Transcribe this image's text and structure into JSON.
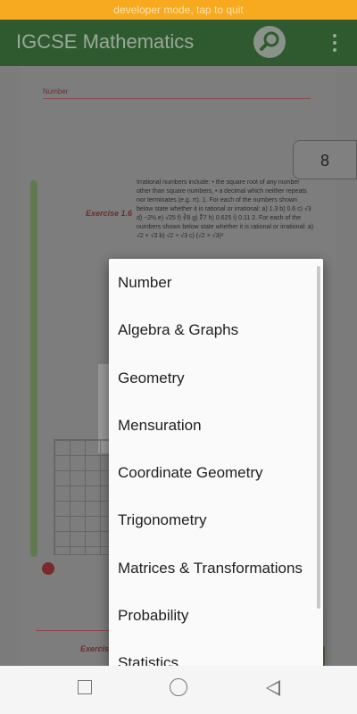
{
  "banner": {
    "text": "developer mode, tap to quit"
  },
  "appbar": {
    "title": "IGCSE Mathematics"
  },
  "page": {
    "section_label": "Number",
    "page_number": "8",
    "exercise_title": "Exercise 1.6",
    "text": "Irrational numbers include: • the square root of any number other than square numbers, • a decimal which neither repeats nor terminates (e.g. π). 1. For each of the numbers shown below state whether it is rational or irrational: a) 1.3 b) 0.6 c) √3 d) −2⅔ e) √25 f) ∛8 g) ∜7 h) 0.625 i) 0.11 2. For each of the numbers shown below state whether it is rational or irrational: a) √2 × √3 b) √2 + √3 c) (√2 × √3)²",
    "lower_exercise": "Exercis"
  },
  "dropdown": {
    "items": [
      "Number",
      "Algebra & Graphs",
      "Geometry",
      "Mensuration",
      "Coordinate Geometry",
      "Trigonometry",
      "Matrices & Transformations",
      "Probability",
      "Statistics"
    ]
  }
}
